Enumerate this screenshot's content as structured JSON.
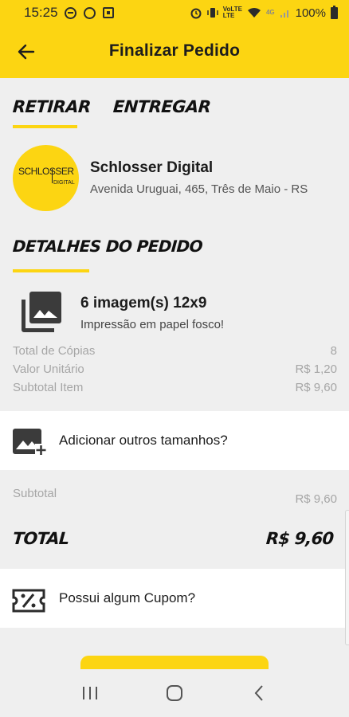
{
  "status_bar": {
    "time": "15:25",
    "net_label_top": "VoLTE",
    "net_label_bottom": "LTE",
    "signal_label": "4G",
    "battery": "100%"
  },
  "header": {
    "title": "Finalizar Pedido"
  },
  "tabs": [
    {
      "label": "RETIRAR",
      "active": true
    },
    {
      "label": "ENTREGAR",
      "active": false
    }
  ],
  "store": {
    "logo_text_main": "SCHLOSSER",
    "logo_text_side": "DIGITAL",
    "name": "Schlosser Digital",
    "address": "Avenida Uruguai, 465, Três de Maio - RS"
  },
  "order": {
    "section_title": "DETALHES DO PEDIDO",
    "item_title": "6 imagem(s) 12x9",
    "item_desc": "Impressão em papel fosco!",
    "rows": [
      {
        "label": "Total de Cópias",
        "value": "8"
      },
      {
        "label": "Valor Unitário",
        "value": "R$ 1,20"
      },
      {
        "label": "Subtotal Item",
        "value": "R$ 9,60"
      }
    ]
  },
  "add_sizes": {
    "label": "Adicionar outros tamanhos?"
  },
  "summary": {
    "subtotal_label": "Subtotal",
    "subtotal_value": "R$ 9,60",
    "total_label": "TOTAL",
    "total_value": "R$ 9,60"
  },
  "coupon": {
    "label": "Possui algum Cupom?"
  },
  "colors": {
    "accent": "#fcd512",
    "background": "#efefef",
    "muted_text": "#a6a6a6"
  },
  "icons": {
    "back": "arrow-left-icon",
    "item": "photo-library-icon",
    "add_sizes": "add-photo-icon",
    "coupon": "coupon-ticket-icon"
  }
}
